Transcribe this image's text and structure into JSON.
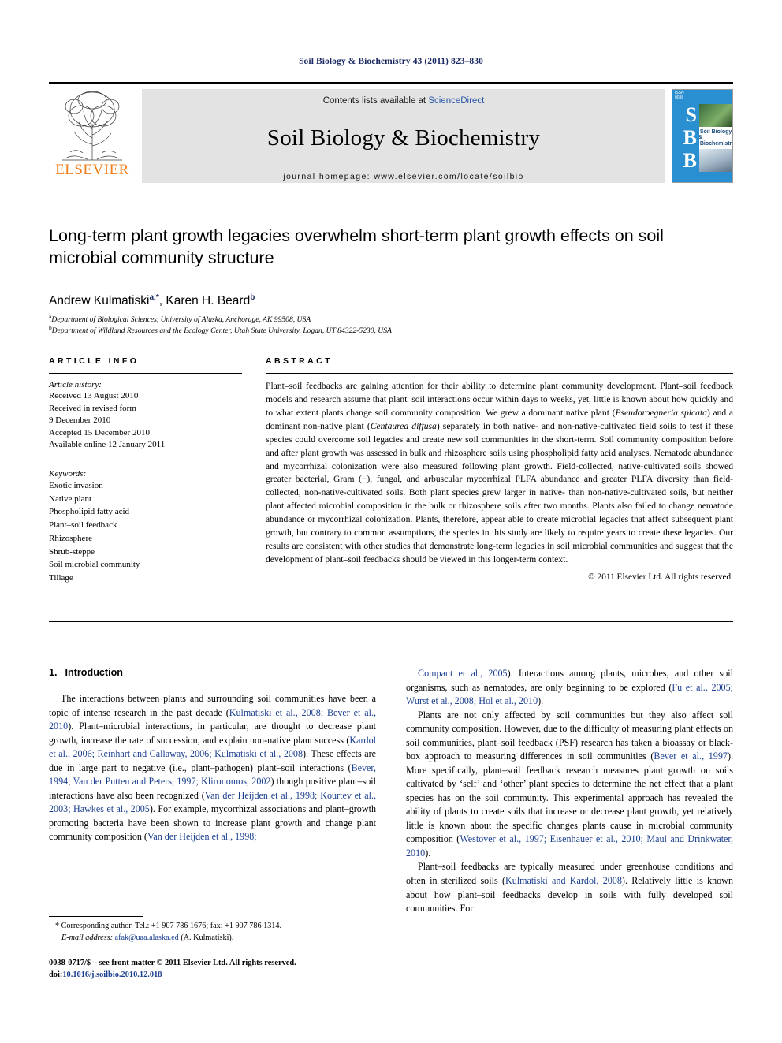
{
  "running_head": "Soil Biology & Biochemistry 43 (2011) 823–830",
  "masthead": {
    "publisher_word": "ELSEVIER",
    "publisher_logo_icon": "elsevier-tree-icon",
    "contents_prefix": "Contents lists available at ",
    "contents_link": "ScienceDirect",
    "journal_name": "Soil Biology & Biochemistry",
    "homepage": "journal homepage: www.elsevier.com/locate/soilbio",
    "cover": {
      "letters": [
        "S",
        "B",
        "B"
      ],
      "title_line1": "Soil Biology &",
      "title_line2": "Biochemistry",
      "accent_color": "#2a8fd0"
    }
  },
  "title": "Long-term plant growth legacies overwhelm short-term plant growth effects on soil microbial community structure",
  "authors": {
    "author1_name": "Andrew Kulmatiski",
    "author1_marks": "a,*",
    "separator": ", ",
    "author2_name": "Karen H. Beard",
    "author2_marks": "b"
  },
  "affiliations": [
    {
      "mark": "a",
      "text": "Department of Biological Sciences, University of Alaska, Anchorage, AK 99508, USA"
    },
    {
      "mark": "b",
      "text": "Department of Wildland Resources and the Ecology Center, Utah State University, Logan, UT 84322-5230, USA"
    }
  ],
  "article_info": {
    "label": "ARTICLE INFO",
    "history_heading": "Article history:",
    "history_lines": [
      "Received 13 August 2010",
      "Received in revised form",
      "9 December 2010",
      "Accepted 15 December 2010",
      "Available online 12 January 2011"
    ],
    "keywords_heading": "Keywords:",
    "keywords": [
      "Exotic invasion",
      "Native plant",
      "Phospholipid fatty acid",
      "Plant–soil feedback",
      "Rhizosphere",
      "Shrub-steppe",
      "Soil microbial community",
      "Tillage"
    ]
  },
  "abstract": {
    "label": "ABSTRACT",
    "paragraph_parts": [
      {
        "type": "text",
        "value": "Plant–soil feedbacks are gaining attention for their ability to determine plant community development. Plant–soil feedback models and research assume that plant–soil interactions occur within days to weeks, yet, little is known about how quickly and to what extent plants change soil community composition. We grew a dominant native plant ("
      },
      {
        "type": "italic",
        "value": "Pseudoroegneria spicata"
      },
      {
        "type": "text",
        "value": ") and a dominant non-native plant ("
      },
      {
        "type": "italic",
        "value": "Centaurea diffusa"
      },
      {
        "type": "text",
        "value": ") separately in both native- and non-native-cultivated field soils to test if these species could overcome soil legacies and create new soil communities in the short-term. Soil community composition before and after plant growth was assessed in bulk and rhizosphere soils using phospholipid fatty acid analyses. Nematode abundance and mycorrhizal colonization were also measured following plant growth. Field-collected, native-cultivated soils showed greater bacterial, Gram (−), fungal, and arbuscular mycorrhizal PLFA abundance and greater PLFA diversity than field-collected, non-native-cultivated soils. Both plant species grew larger in native- than non-native-cultivated soils, but neither plant affected microbial composition in the bulk or rhizosphere soils after two months. Plants also failed to change nematode abundance or mycorrhizal colonization. Plants, therefore, appear able to create microbial legacies that affect subsequent plant growth, but contrary to common assumptions, the species in this study are likely to require years to create these legacies. Our results are consistent with other studies that demonstrate long-term legacies in soil microbial communities and suggest that the development of plant–soil feedbacks should be viewed in this longer-term context."
      }
    ],
    "copyright": "© 2011 Elsevier Ltd. All rights reserved."
  },
  "introduction": {
    "number": "1.",
    "heading": "Introduction",
    "left_column_paragraphs": [
      [
        {
          "type": "text",
          "value": "The interactions between plants and surrounding soil communities have been a topic of intense research in the past decade ("
        },
        {
          "type": "cite",
          "value": "Kulmatiski et al., 2008; Bever et al., 2010"
        },
        {
          "type": "text",
          "value": "). Plant–microbial interactions, in particular, are thought to decrease plant growth, increase the rate of succession, and explain non-native plant success ("
        },
        {
          "type": "cite",
          "value": "Kardol et al., 2006; Reinhart and Callaway, 2006; Kulmatiski et al., 2008"
        },
        {
          "type": "text",
          "value": "). These effects are due in large part to negative (i.e., plant–pathogen) plant–soil interactions ("
        },
        {
          "type": "cite",
          "value": "Bever, 1994; Van der Putten and Peters, 1997; Klironomos, 2002"
        },
        {
          "type": "text",
          "value": ") though positive plant–soil interactions have also been recognized ("
        },
        {
          "type": "cite",
          "value": "Van der Heijden et al., 1998; Kourtev et al., 2003; Hawkes et al., 2005"
        },
        {
          "type": "text",
          "value": "). For example, mycorrhizal associations and plant–growth promoting bacteria have been shown to increase plant growth and change plant community composition ("
        },
        {
          "type": "cite",
          "value": "Van der Heijden et al., 1998;"
        }
      ]
    ],
    "right_column_paragraphs": [
      [
        {
          "type": "cite",
          "value": "Compant et al., 2005"
        },
        {
          "type": "text",
          "value": "). Interactions among plants, microbes, and other soil organisms, such as nematodes, are only beginning to be explored ("
        },
        {
          "type": "cite",
          "value": "Fu et al., 2005; Wurst et al., 2008; Hol et al., 2010"
        },
        {
          "type": "text",
          "value": ")."
        }
      ],
      [
        {
          "type": "text",
          "value": "Plants are not only affected by soil communities but they also affect soil community composition. However, due to the difficulty of measuring plant effects on soil communities, plant–soil feedback (PSF) research has taken a bioassay or black-box approach to measuring differences in soil communities ("
        },
        {
          "type": "cite",
          "value": "Bever et al., 1997"
        },
        {
          "type": "text",
          "value": "). More specifically, plant–soil feedback research measures plant growth on soils cultivated by ‘self’ and ‘other’ plant species to determine the net effect that a plant species has on the soil community. This experimental approach has revealed the ability of plants to create soils that increase or decrease plant growth, yet relatively little is known about the specific changes plants cause in microbial community composition ("
        },
        {
          "type": "cite",
          "value": "Westover et al., 1997; Eisenhauer et al., 2010; Maul and Drinkwater, 2010"
        },
        {
          "type": "text",
          "value": ")."
        }
      ],
      [
        {
          "type": "text",
          "value": "Plant–soil feedbacks are typically measured under greenhouse conditions and often in sterilized soils ("
        },
        {
          "type": "cite",
          "value": "Kulmatiski and Kardol, 2008"
        },
        {
          "type": "text",
          "value": "). Relatively little is known about how plant–soil feedbacks develop in soils with fully developed soil communities. For"
        }
      ]
    ]
  },
  "footnote": {
    "star": "*",
    "corresponding": "Corresponding author. Tel.: +1 907 786 1676; fax: +1 907 786 1314.",
    "email_label": "E-mail address:",
    "email": "afak@uaa.alaska.ed",
    "email_suffix": "(A. Kulmatiski)."
  },
  "imprint": {
    "line1": "0038-0717/$ – see front matter © 2011 Elsevier Ltd. All rights reserved.",
    "doi_label": "doi:",
    "doi": "10.1016/j.soilbio.2010.12.018"
  },
  "colors": {
    "running_head": "#1b2a63",
    "citation_link": "#1b3f8f",
    "sciencedirect": "#2a56a8",
    "elsevier_orange": "#f07d1a",
    "banner_gray": "#e3e3e3"
  }
}
